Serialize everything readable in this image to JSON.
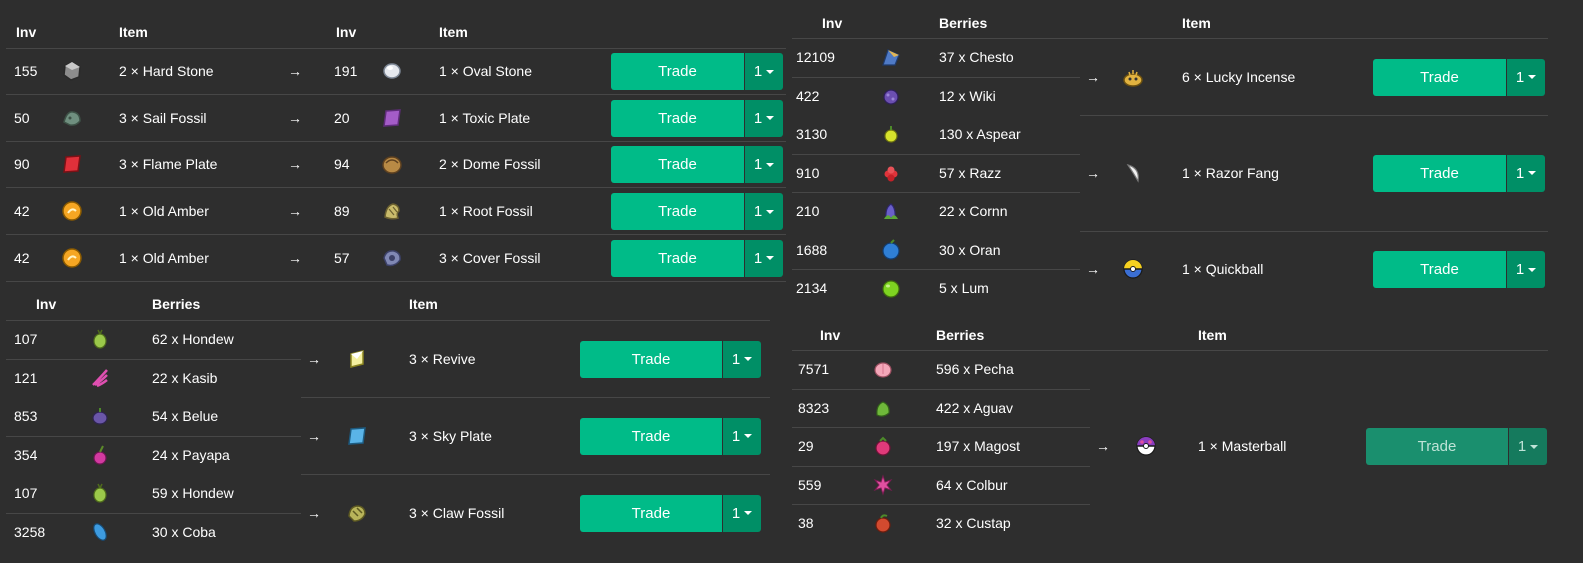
{
  "headers": {
    "inv": "Inv",
    "item": "Item",
    "berries": "Berries"
  },
  "trade_label": "Trade",
  "qty_label": "1",
  "arrow": "→",
  "item_trades": [
    {
      "inv_in": "155",
      "give": "2 × Hard Stone",
      "give_icon": "hard-stone-icon",
      "inv_out": "191",
      "get": "1 × Oval Stone",
      "get_icon": "oval-stone-icon"
    },
    {
      "inv_in": "50",
      "give": "3 × Sail Fossil",
      "give_icon": "sail-fossil-icon",
      "inv_out": "20",
      "get": "1 × Toxic Plate",
      "get_icon": "toxic-plate-icon"
    },
    {
      "inv_in": "90",
      "give": "3 × Flame Plate",
      "give_icon": "flame-plate-icon",
      "inv_out": "94",
      "get": "2 × Dome Fossil",
      "get_icon": "dome-fossil-icon"
    },
    {
      "inv_in": "42",
      "give": "1 × Old Amber",
      "give_icon": "old-amber-icon",
      "inv_out": "89",
      "get": "1 × Root Fossil",
      "get_icon": "root-fossil-icon"
    },
    {
      "inv_in": "42",
      "give": "1 × Old Amber",
      "give_icon": "old-amber-icon",
      "inv_out": "57",
      "get": "3 × Cover Fossil",
      "get_icon": "cover-fossil-icon"
    }
  ],
  "berry_trades_a": [
    {
      "berries": [
        {
          "inv": "107",
          "name": "62 x Hondew",
          "icon": "hondew-berry-icon"
        },
        {
          "inv": "121",
          "name": "22 x Kasib",
          "icon": "kasib-berry-icon"
        }
      ],
      "item": "3 × Revive",
      "item_icon": "revive-icon"
    },
    {
      "berries": [
        {
          "inv": "853",
          "name": "54 x Belue",
          "icon": "belue-berry-icon"
        },
        {
          "inv": "354",
          "name": "24 x Payapa",
          "icon": "payapa-berry-icon"
        }
      ],
      "item": "3 × Sky Plate",
      "item_icon": "sky-plate-icon"
    },
    {
      "berries": [
        {
          "inv": "107",
          "name": "59 x Hondew",
          "icon": "hondew-berry-icon"
        },
        {
          "inv": "3258",
          "name": "30 x Coba",
          "icon": "coba-berry-icon"
        }
      ],
      "item": "3 × Claw Fossil",
      "item_icon": "claw-fossil-icon"
    }
  ],
  "berry_trades_b": [
    {
      "berries": [
        {
          "inv": "12109",
          "name": "37 x Chesto",
          "icon": "chesto-berry-icon"
        },
        {
          "inv": "422",
          "name": "12 x Wiki",
          "icon": "wiki-berry-icon"
        }
      ],
      "item": "6 × Lucky Incense",
      "item_icon": "lucky-incense-icon"
    },
    {
      "berries": [
        {
          "inv": "3130",
          "name": "130 x Aspear",
          "icon": "aspear-berry-icon"
        },
        {
          "inv": "910",
          "name": "57 x Razz",
          "icon": "razz-berry-icon"
        },
        {
          "inv": "210",
          "name": "22 x Cornn",
          "icon": "cornn-berry-icon"
        }
      ],
      "item": "1 × Razor Fang",
      "item_icon": "razor-fang-icon"
    },
    {
      "berries": [
        {
          "inv": "1688",
          "name": "30 x Oran",
          "icon": "oran-berry-icon"
        },
        {
          "inv": "2134",
          "name": "5 x Lum",
          "icon": "lum-berry-icon"
        }
      ],
      "item": "1 × Quickball",
      "item_icon": "quick-ball-icon"
    }
  ],
  "berry_trades_c": [
    {
      "berries": [
        {
          "inv": "7571",
          "name": "596 x Pecha",
          "icon": "pecha-berry-icon"
        },
        {
          "inv": "8323",
          "name": "422 x Aguav",
          "icon": "aguav-berry-icon"
        },
        {
          "inv": "29",
          "name": "197 x Magost",
          "icon": "magost-berry-icon"
        },
        {
          "inv": "559",
          "name": "64 x Colbur",
          "icon": "colbur-berry-icon"
        },
        {
          "inv": "38",
          "name": "32 x Custap",
          "icon": "custap-berry-icon"
        }
      ],
      "item": "1 × Masterball",
      "item_icon": "master-ball-icon",
      "disabled": true
    }
  ],
  "colors": {
    "background": "#2e2e2e",
    "trade_button": "#00bb88",
    "qty_button": "#008f66",
    "divider": "#474747"
  }
}
